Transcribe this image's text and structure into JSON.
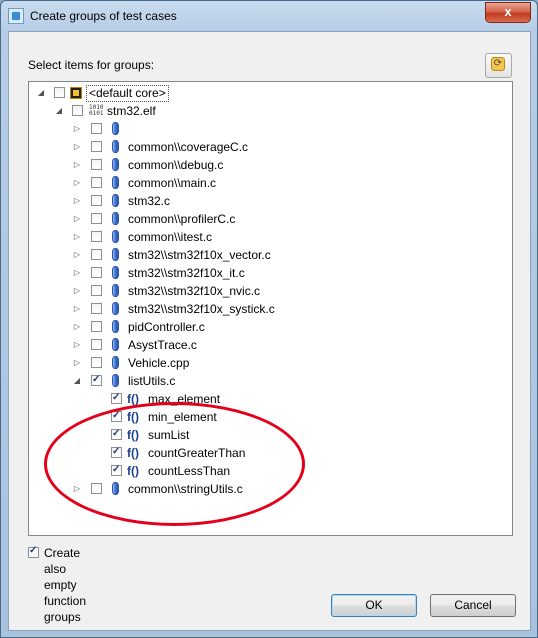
{
  "window": {
    "title": "Create groups of test cases",
    "close_glyph": "x"
  },
  "section_label": "Select items for groups:",
  "refresh_button": {
    "icon": "refresh-icon",
    "glyph": "⟳"
  },
  "tree": {
    "core": {
      "label": "<default core>",
      "expanded": true,
      "checked": false
    },
    "elf": {
      "label": "stm32.elf",
      "expanded": true,
      "checked": false,
      "icon_text": "1010\n0101"
    },
    "files": [
      {
        "label": "",
        "checked": false,
        "expanded": false
      },
      {
        "label": "common\\\\coverageC.c",
        "checked": false,
        "expanded": false
      },
      {
        "label": "common\\\\debug.c",
        "checked": false,
        "expanded": false
      },
      {
        "label": "common\\\\main.c",
        "checked": false,
        "expanded": false
      },
      {
        "label": "stm32.c",
        "checked": false,
        "expanded": false
      },
      {
        "label": "common\\\\profilerC.c",
        "checked": false,
        "expanded": false
      },
      {
        "label": "common\\\\itest.c",
        "checked": false,
        "expanded": false
      },
      {
        "label": "stm32\\\\stm32f10x_vector.c",
        "checked": false,
        "expanded": false
      },
      {
        "label": "stm32\\\\stm32f10x_it.c",
        "checked": false,
        "expanded": false
      },
      {
        "label": "stm32\\\\stm32f10x_nvic.c",
        "checked": false,
        "expanded": false
      },
      {
        "label": "stm32\\\\stm32f10x_systick.c",
        "checked": false,
        "expanded": false
      },
      {
        "label": "pidController.c",
        "checked": false,
        "expanded": false
      },
      {
        "label": "AsystTrace.c",
        "checked": false,
        "expanded": false
      },
      {
        "label": "Vehicle.cpp",
        "checked": false,
        "expanded": false
      },
      {
        "label": "listUtils.c",
        "checked": true,
        "expanded": true
      },
      {
        "label": "common\\\\stringUtils.c",
        "checked": false,
        "expanded": false
      }
    ],
    "functions": [
      {
        "label": "max_element",
        "checked": true
      },
      {
        "label": "min_element",
        "checked": true
      },
      {
        "label": "sumList",
        "checked": true
      },
      {
        "label": "countGreaterThan",
        "checked": true
      },
      {
        "label": "countLessThan",
        "checked": true
      }
    ],
    "function_icon_text": "f()",
    "highlight_color": "#e4001b"
  },
  "option": {
    "label": "Create also empty function groups",
    "checked": true
  },
  "buttons": {
    "ok": "OK",
    "cancel": "Cancel"
  }
}
